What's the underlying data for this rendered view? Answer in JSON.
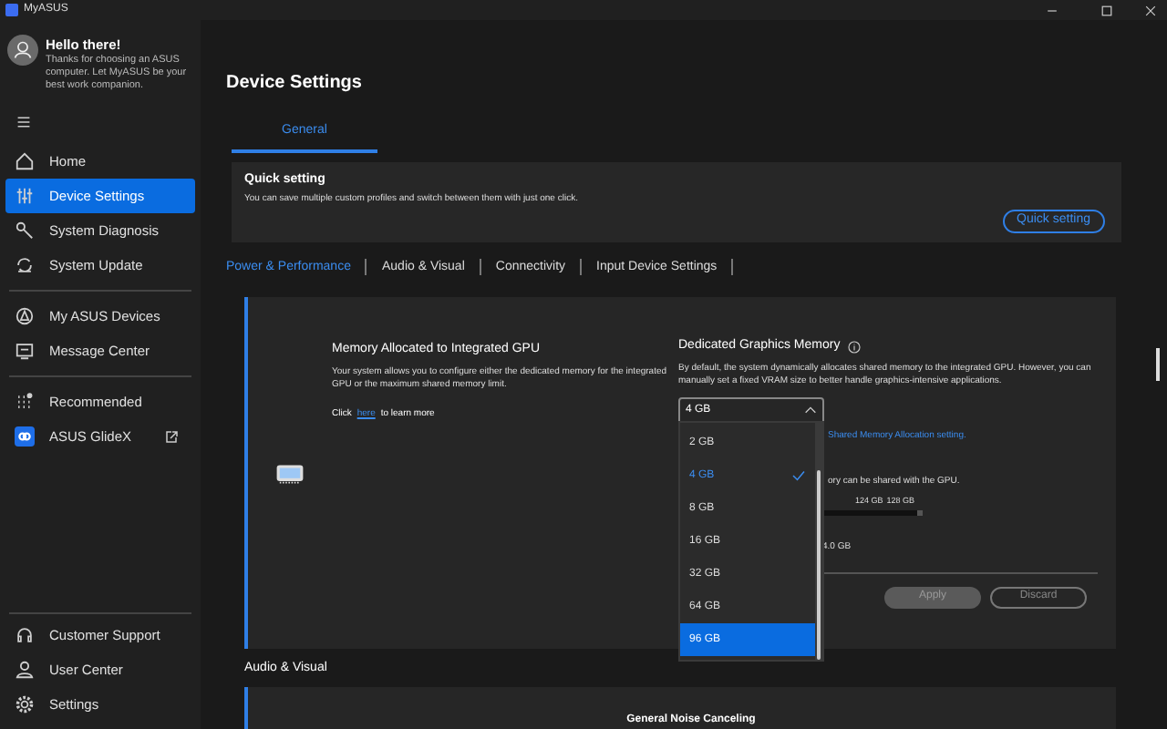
{
  "app": {
    "title": "MyASUS"
  },
  "sidebar": {
    "greeting": {
      "title": "Hello there!",
      "text": "Thanks for choosing an ASUS computer. Let MyASUS be your best work companion."
    },
    "groups": [
      {
        "items": [
          {
            "label": "Home",
            "selected": false
          },
          {
            "label": "Device Settings",
            "selected": true
          },
          {
            "label": "System Diagnosis",
            "selected": false
          },
          {
            "label": "System Update",
            "selected": false
          }
        ]
      },
      {
        "items": [
          {
            "label": "My ASUS Devices",
            "selected": false
          },
          {
            "label": "Message Center",
            "selected": false
          }
        ]
      },
      {
        "items": [
          {
            "label": "Recommended",
            "selected": false
          },
          {
            "label": "ASUS GlideX",
            "selected": false,
            "external": true
          }
        ]
      }
    ],
    "bottom_items": [
      {
        "label": "Customer Support",
        "selected": false
      },
      {
        "label": "User Center",
        "selected": false
      },
      {
        "label": "Settings",
        "selected": false
      }
    ]
  },
  "page": {
    "title": "Device Settings",
    "tabs": [
      {
        "label": "General",
        "selected": true
      }
    ],
    "quick_setting": {
      "title": "Quick setting",
      "text": "You can save multiple custom profiles and switch between them with just one click.",
      "button": "Quick setting"
    },
    "section_tabs": [
      {
        "label": "Power & Performance",
        "selected": true
      },
      {
        "label": "Audio & Visual",
        "selected": false
      },
      {
        "label": "Connectivity",
        "selected": false
      },
      {
        "label": "Input Device Settings",
        "selected": false
      }
    ],
    "memory_card": {
      "title": "Memory Allocated to Integrated GPU",
      "description": "Your system allows you to configure either the dedicated memory for the integrated GPU or the maximum shared memory limit.",
      "link_prefix": "Click",
      "link": "here",
      "link_suffix": "to learn more",
      "setting_title": "Dedicated Graphics Memory",
      "setting_text": "By default, the system dynamically allocates shared memory to the integrated GPU. However, you can manually set a fixed VRAM size to better handle graphics-intensive applications.",
      "dropdown": {
        "value": "4 GB",
        "expanded": true,
        "options": [
          {
            "label": "2 GB",
            "selected": false,
            "hovered": false
          },
          {
            "label": "4 GB",
            "selected": true,
            "hovered": false
          },
          {
            "label": "8 GB",
            "selected": false,
            "hovered": false
          },
          {
            "label": "16 GB",
            "selected": false,
            "hovered": false
          },
          {
            "label": "32 GB",
            "selected": false,
            "hovered": false
          },
          {
            "label": "64 GB",
            "selected": false,
            "hovered": false
          },
          {
            "label": "96 GB",
            "selected": false,
            "hovered": true
          }
        ]
      },
      "shared_link": "Shared Memory Allocation setting.",
      "shared_text": "ory can be shared with the GPU.",
      "slider": {
        "labels": [
          "124 GB",
          "128 GB"
        ],
        "level": 0.97,
        "reading": "4.0 GB"
      },
      "buttons": [
        {
          "label": "Apply",
          "disabled": true
        },
        {
          "label": "Discard",
          "disabled": false
        }
      ]
    },
    "next_section": {
      "title": "Audio & Visual",
      "card_title": "General Noise Canceling"
    }
  }
}
